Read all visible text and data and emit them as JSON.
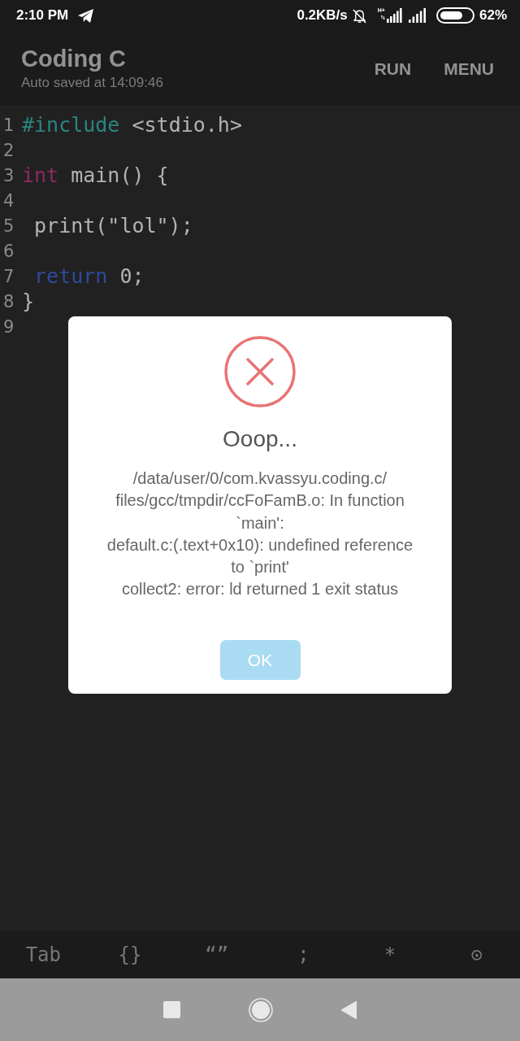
{
  "status_bar": {
    "time": "2:10 PM",
    "net_speed": "0.2KB/s",
    "network_type": "H+",
    "battery": "62%"
  },
  "app_bar": {
    "title": "Coding C",
    "subtitle": "Auto saved at 14:09:46",
    "actions": [
      "RUN",
      "MENU"
    ]
  },
  "editor": {
    "lines": [
      {
        "number": "1",
        "tokens": [
          {
            "text": "#include",
            "kind": "directive"
          },
          {
            "text": " <stdio.h>",
            "kind": "plain"
          }
        ]
      },
      {
        "number": "2"
      },
      {
        "number": "3",
        "tokens": [
          {
            "text": "int",
            "kind": "type"
          },
          {
            "text": " main() {",
            "kind": "plain"
          }
        ]
      },
      {
        "number": "4"
      },
      {
        "number": "5",
        "tokens": [
          {
            "text": " print(\"lol\");",
            "kind": "plain"
          }
        ]
      },
      {
        "number": "6"
      },
      {
        "number": "7",
        "tokens": [
          {
            "text": " return",
            "kind": "keyword"
          },
          {
            "text": " 0;",
            "kind": "plain"
          }
        ]
      },
      {
        "number": "8",
        "tokens": [
          {
            "text": "}",
            "kind": "plain"
          }
        ]
      },
      {
        "number": "9"
      }
    ]
  },
  "dialog": {
    "title": "Ooop...",
    "message_lines": [
      "/data/user/0/com.kvassyu.coding.c/",
      "files/gcc/tmpdir/ccFoFamB.o: In function",
      "`main':",
      "default.c:(.text+0x10): undefined reference",
      "to `print'",
      "collect2: error: ld returned 1 exit status"
    ],
    "button": "OK"
  },
  "key_bar": {
    "keys": [
      "Tab",
      "{}",
      "“”",
      ";",
      "*",
      "⊙"
    ]
  }
}
